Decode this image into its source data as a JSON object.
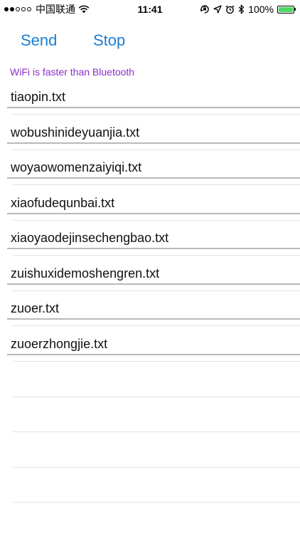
{
  "status_bar": {
    "carrier": "中国联通",
    "time": "11:41",
    "battery_percent": "100%",
    "signal_bars_filled": 2,
    "signal_bars_total": 5,
    "battery_level": 1.0,
    "icons": [
      "wifi-icon",
      "orientation-lock-icon",
      "location-arrow-icon",
      "alarm-icon",
      "bluetooth-icon",
      "battery-icon"
    ]
  },
  "toolbar": {
    "send_label": "Send",
    "stop_label": "Stop",
    "accent_color": "#1a7fd3"
  },
  "info": {
    "text": "WiFi is faster than Bluetooth",
    "color": "#8a2fc9"
  },
  "files": [
    {
      "name": "tiaopin.txt"
    },
    {
      "name": "wobushinideyuanjia.txt"
    },
    {
      "name": "woyaowomenzaiyiqi.txt"
    },
    {
      "name": "xiaofudequnbai.txt"
    },
    {
      "name": "xiaoyaodejinsechengbao.txt"
    },
    {
      "name": "zuishuxidemoshengren.txt"
    },
    {
      "name": "zuoer.txt"
    },
    {
      "name": "zuoerzhongjie.txt"
    }
  ]
}
